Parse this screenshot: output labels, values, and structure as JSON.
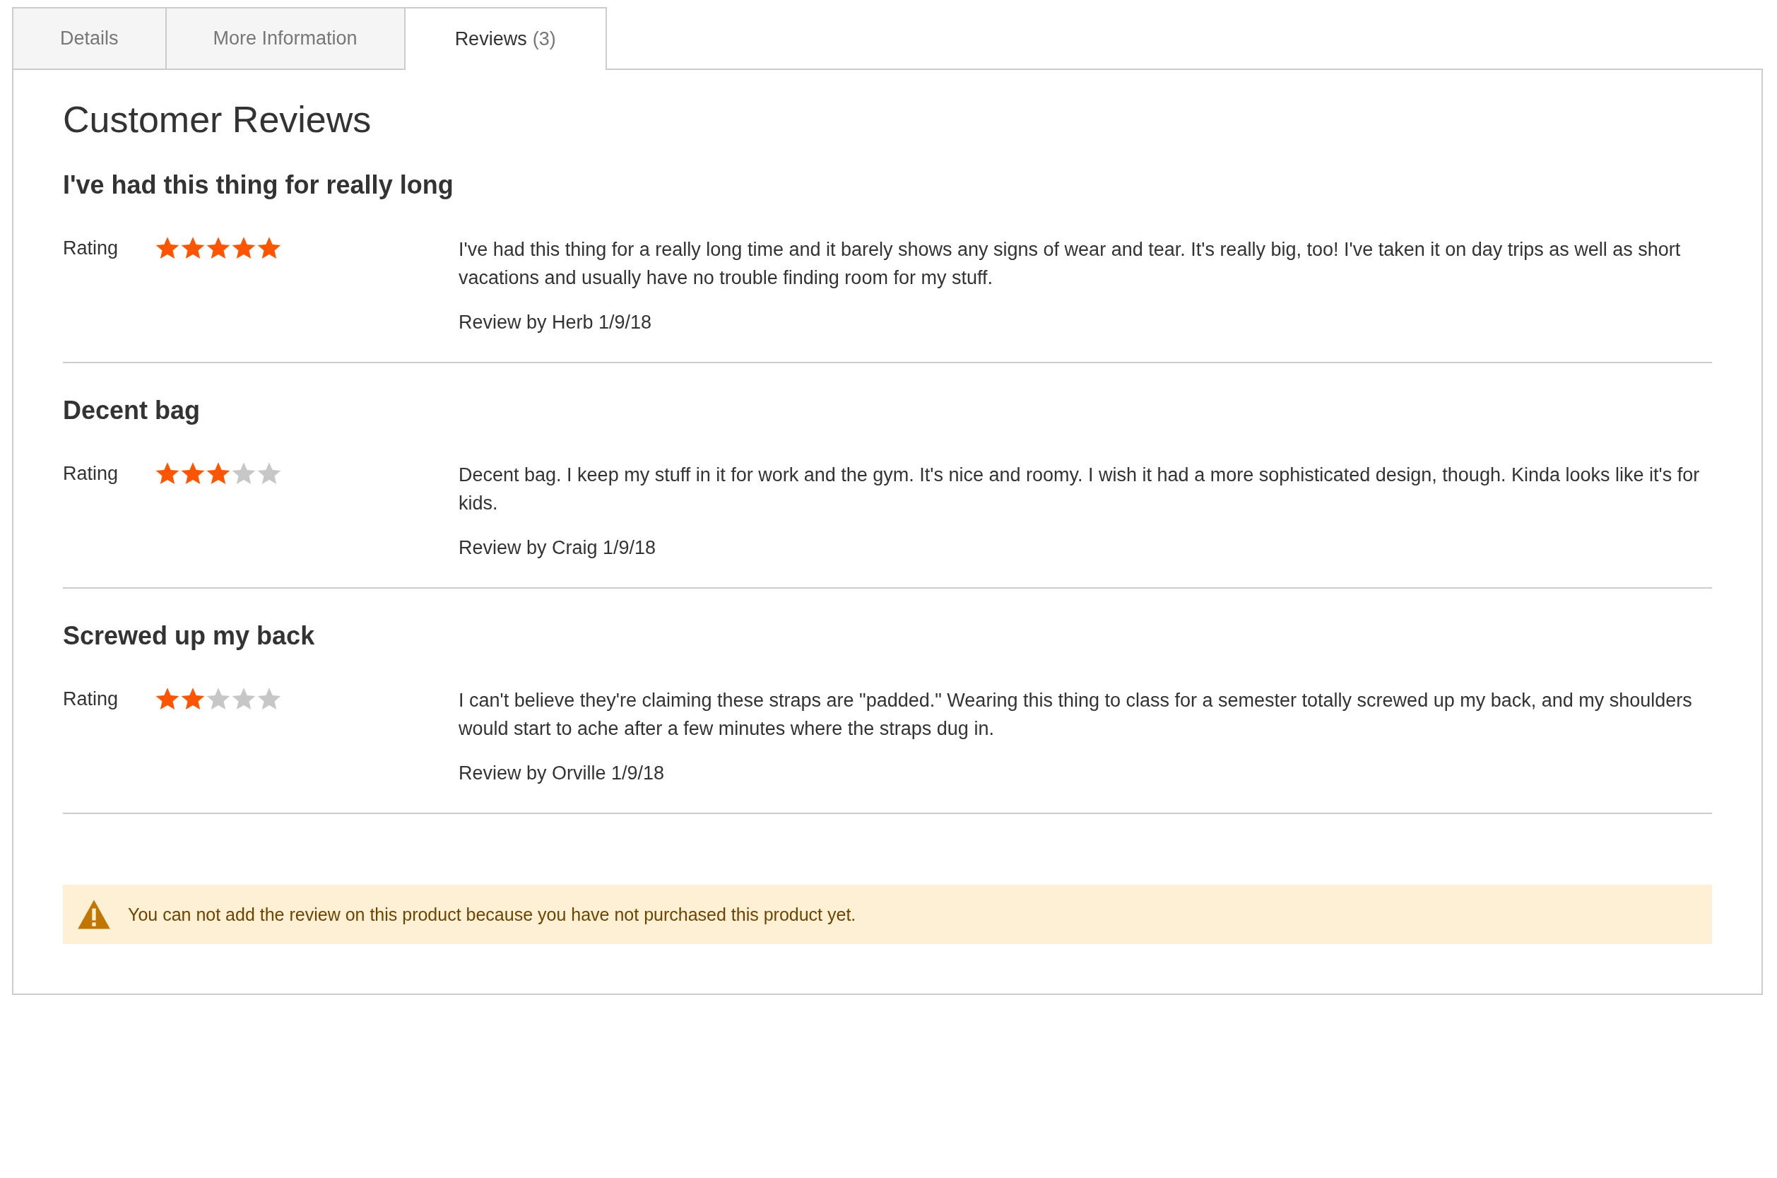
{
  "tabs": [
    {
      "label": "Details",
      "selected": false
    },
    {
      "label": "More Information",
      "selected": false
    },
    {
      "label": "Reviews",
      "count": "(3)",
      "selected": true
    }
  ],
  "heading": "Customer Reviews",
  "reviews": [
    {
      "title": "I've had this thing for really long",
      "rating_label": "Rating",
      "stars": 5,
      "text": "I've had this thing for a really long time and it barely shows any signs of wear and tear. It's really big, too! I've taken it on day trips as well as short vacations and usually have no trouble finding room for my stuff.",
      "byline": "Review by Herb 1/9/18"
    },
    {
      "title": "Decent bag",
      "rating_label": "Rating",
      "stars": 3,
      "text": "Decent bag. I keep my stuff in it for work and the gym. It's nice and roomy. I wish it had a more sophisticated design, though. Kinda looks like it's for kids.",
      "byline": "Review by Craig 1/9/18"
    },
    {
      "title": "Screwed up my back",
      "rating_label": "Rating",
      "stars": 2,
      "text": "I can't believe they're claiming these straps are \"padded.\" Wearing this thing to class for a semester totally screwed up my back, and my shoulders would start to ache after a few minutes where the straps dug in.",
      "byline": "Review by Orville 1/9/18"
    }
  ],
  "notice": {
    "text": "You can not add the review on this product because you have not purchased this product yet."
  }
}
